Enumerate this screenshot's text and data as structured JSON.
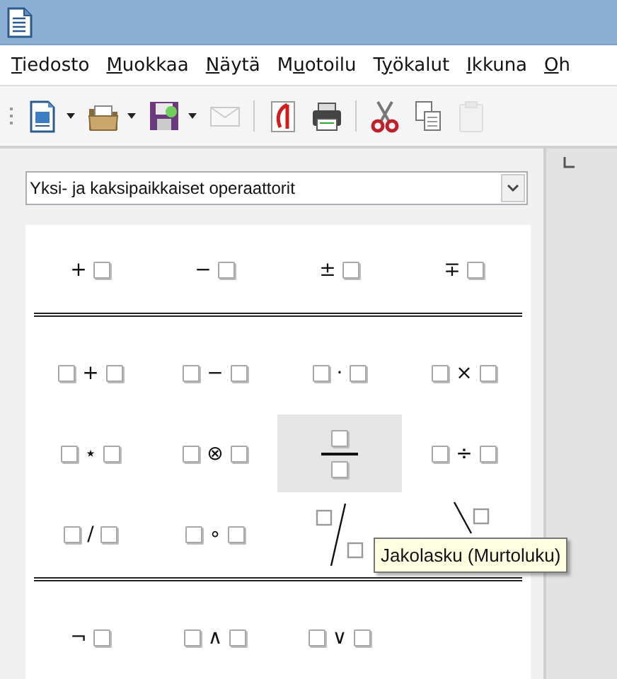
{
  "menu": [
    {
      "key": "T",
      "after": "iedosto"
    },
    {
      "key": "M",
      "after": "uokkaa"
    },
    {
      "key": "N",
      "after": "äytä"
    },
    {
      "before": "M",
      "key": "u",
      "after": "otoilu"
    },
    {
      "before": "T",
      "key": "y",
      "after": "ökalut"
    },
    {
      "key": "I",
      "after": "kkuna"
    },
    {
      "key": "O",
      "after": "h"
    }
  ],
  "toolbar": [
    {
      "kind": "new-document",
      "dropdown": true,
      "disabled": false
    },
    {
      "kind": "open-folder",
      "dropdown": true,
      "disabled": false
    },
    {
      "kind": "save",
      "dropdown": true,
      "disabled": false
    },
    {
      "kind": "mail",
      "dropdown": false,
      "disabled": true
    },
    {
      "kind": "separator"
    },
    {
      "kind": "pdf",
      "dropdown": false,
      "disabled": false
    },
    {
      "kind": "print",
      "dropdown": false,
      "disabled": false
    },
    {
      "kind": "separator"
    },
    {
      "kind": "cut",
      "dropdown": false,
      "disabled": false
    },
    {
      "kind": "copy",
      "dropdown": false,
      "disabled": false
    },
    {
      "kind": "paste",
      "dropdown": false,
      "disabled": true
    }
  ],
  "category_dropdown": {
    "value": "Yksi- ja kaksipaikkaiset operaattorit"
  },
  "groups": [
    {
      "cells": [
        {
          "kind": "inline",
          "symbol": "+",
          "left": false,
          "selected": false
        },
        {
          "kind": "inline",
          "symbol": "−",
          "left": false,
          "selected": false
        },
        {
          "kind": "inline",
          "symbol": "±",
          "left": false,
          "selected": false
        },
        {
          "kind": "inline",
          "symbol": "∓",
          "left": false,
          "selected": false
        }
      ]
    },
    {
      "cells": [
        {
          "kind": "inline",
          "symbol": "+",
          "left": true,
          "selected": false
        },
        {
          "kind": "inline",
          "symbol": "−",
          "left": true,
          "selected": false
        },
        {
          "kind": "inline",
          "symbol": "·",
          "left": true,
          "selected": false
        },
        {
          "kind": "inline",
          "symbol": "×",
          "left": true,
          "selected": false
        },
        {
          "kind": "inline",
          "symbol": "⋆",
          "left": true,
          "selected": false
        },
        {
          "kind": "inline",
          "symbol": "⊗",
          "left": true,
          "selected": false
        },
        {
          "kind": "fraction",
          "selected": true
        },
        {
          "kind": "inline",
          "symbol": "÷",
          "left": true,
          "selected": false
        },
        {
          "kind": "inline",
          "symbol": "/",
          "left": true,
          "selected": false
        },
        {
          "kind": "inline",
          "symbol": "∘",
          "left": true,
          "selected": false
        },
        {
          "kind": "wide-slash",
          "selected": false
        },
        {
          "kind": "wide-backslash",
          "selected": false
        }
      ]
    },
    {
      "cells": [
        {
          "kind": "inline",
          "symbol": "¬",
          "left": false,
          "selected": false
        },
        {
          "kind": "inline",
          "symbol": "∧",
          "left": true,
          "selected": false
        },
        {
          "kind": "inline",
          "symbol": "∨",
          "left": true,
          "selected": false
        }
      ]
    }
  ],
  "tooltip": {
    "text": "Jakolasku (Murtoluku)"
  }
}
